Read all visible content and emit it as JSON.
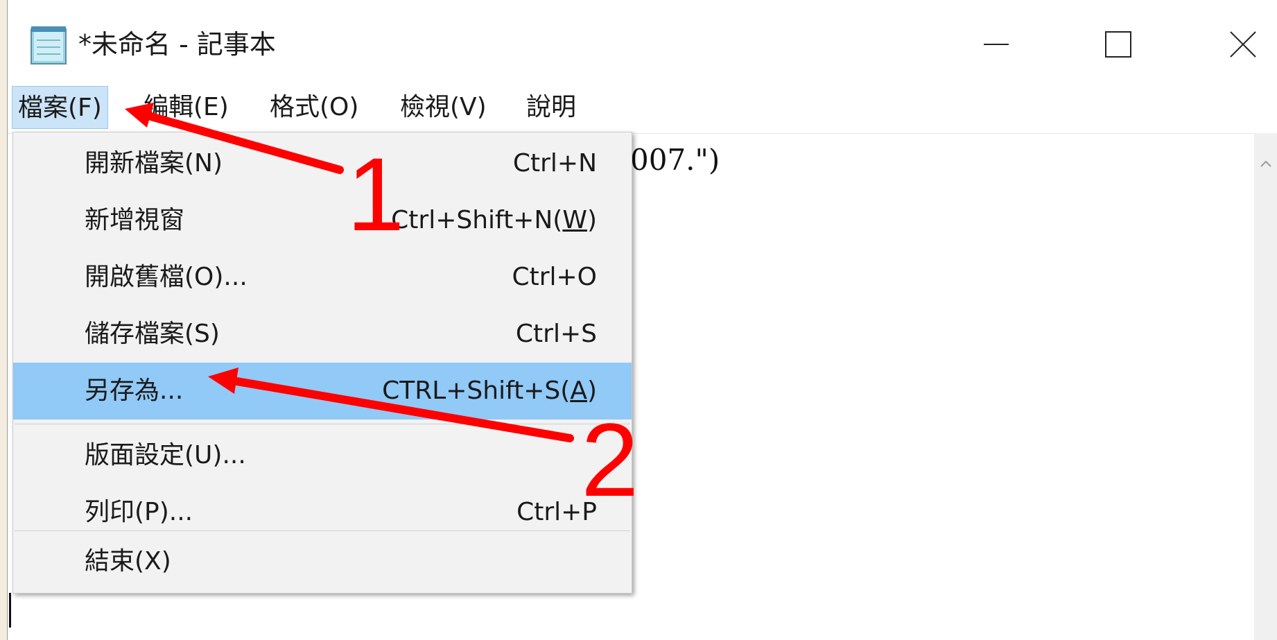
{
  "window": {
    "title": "*未命名 - 記事本",
    "icon": "notepad-icon",
    "controls": [
      "minimize-icon",
      "maximize-icon",
      "close-icon"
    ]
  },
  "menubar": {
    "items": [
      {
        "label": "檔案(F)",
        "active": true
      },
      {
        "label": "編輯(E)"
      },
      {
        "label": "格式(O)"
      },
      {
        "label": "檢視(V)"
      },
      {
        "label": "說明"
      }
    ]
  },
  "file_menu": {
    "items": [
      {
        "label": "開新檔案(N)",
        "shortcut": "Ctrl+N"
      },
      {
        "label": "新增視窗",
        "shortcut_pre": "Ctrl+Shift+N(",
        "shortcut_u": "W",
        "shortcut_post": ")"
      },
      {
        "label": "開啟舊檔(O)...",
        "shortcut": "Ctrl+O"
      },
      {
        "label": "儲存檔案(S)",
        "shortcut": "Ctrl+S"
      },
      {
        "label": "另存為...",
        "shortcut_pre": "CTRL+Shift+S(",
        "shortcut_u": "A",
        "shortcut_post": ")",
        "highlighted": true
      },
      {
        "label": "版面設定(U)..."
      },
      {
        "label": "列印(P)...",
        "shortcut": "Ctrl+P"
      },
      {
        "label": "結束(X)"
      }
    ]
  },
  "editor": {
    "visible_text": "007.\")"
  },
  "annotations": {
    "step1": "1",
    "step2": "2",
    "color": "#ff0000"
  },
  "colors": {
    "menu_active_bg": "#cce4f7",
    "item_highlight_bg": "#91c9f7",
    "menu_bg": "#f2f2f2"
  }
}
